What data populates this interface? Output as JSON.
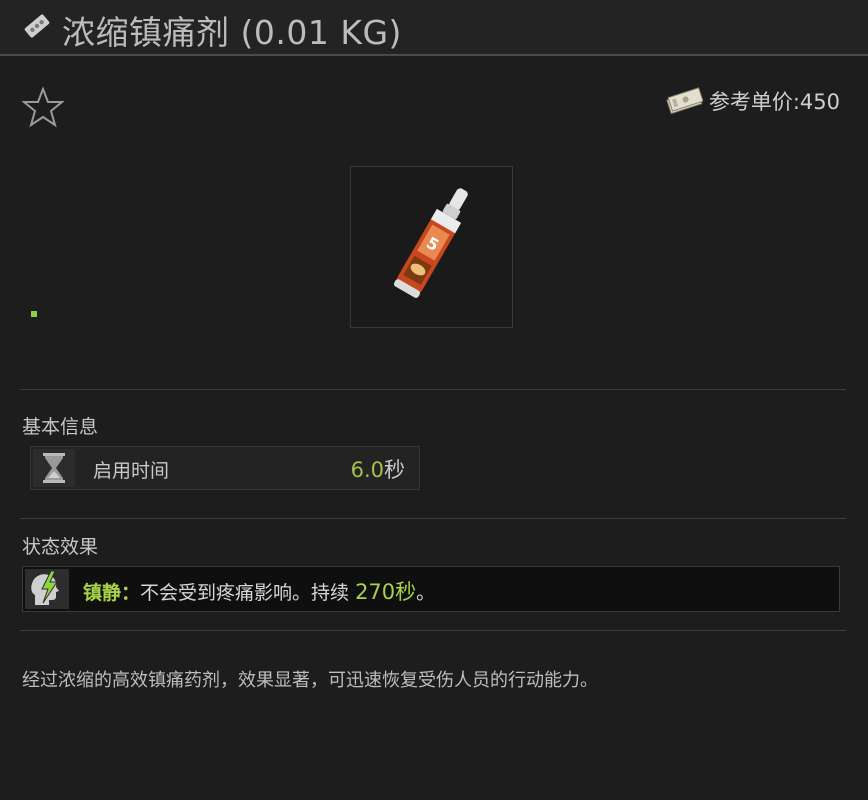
{
  "header": {
    "title": "浓缩镇痛剂 (0.01 KG)",
    "title_icon": "pill-blister-icon"
  },
  "toolbar": {
    "favorite_icon": "star-outline-icon",
    "price_label": "参考单价:450",
    "price_icon": "cash-bundle-icon"
  },
  "item": {
    "image_icon": "painkiller-tube-icon"
  },
  "basic_info": {
    "section_title": "基本信息",
    "rows": [
      {
        "icon": "hourglass-icon",
        "label": "启用时间",
        "value": "6.0",
        "unit": "秒"
      }
    ]
  },
  "status_effects": {
    "section_title": "状态效果",
    "effects": [
      {
        "icon": "head-lightning-icon",
        "name": "镇静：",
        "description": "不会受到疼痛影响。持续 ",
        "duration": "270秒",
        "suffix": "。"
      }
    ]
  },
  "description": "经过浓缩的高效镇痛药剂，效果显著，可迅速恢复受伤人员的行动能力。",
  "colors": {
    "accent_green": "#a8d24a",
    "value_yellow_green": "#a6c04a",
    "background": "#1d1d1d"
  }
}
